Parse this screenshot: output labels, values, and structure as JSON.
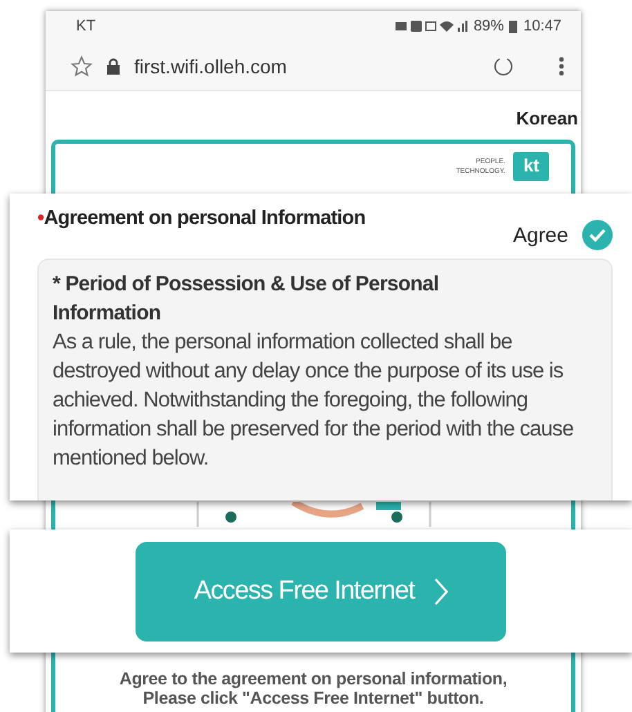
{
  "status_bar": {
    "carrier": "KT",
    "battery": "89%",
    "time": "10:47"
  },
  "address_bar": {
    "url": "first.wifi.olleh.com"
  },
  "language_link": "Korean",
  "logo": {
    "tagline": [
      "PEOPLE.",
      "TECHNOLOGY."
    ],
    "mark": "kt"
  },
  "agreement": {
    "required_mark": "•",
    "title": "Agreement on personal Information",
    "agree_label": "Agree",
    "checked": true,
    "notice": {
      "heading": "* Period of Possession & Use of Personal Information",
      "body": "As a rule, the personal information collected shall be destroyed without any delay once the purpose of its use is achieved. Notwithstanding the foregoing, the following information shall be preserved for the period with the cause mentioned below."
    }
  },
  "access_button": {
    "label": "Access Free Internet"
  },
  "footer_note": [
    "Agree to the agreement on personal information,",
    "Please click \"Access Free Internet\" button."
  ]
}
